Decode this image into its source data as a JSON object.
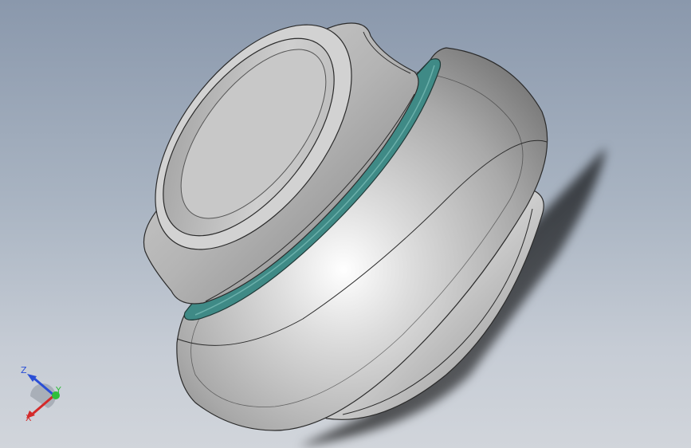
{
  "viewport": {
    "background_top": "#8a98ac",
    "background_bottom": "#d1d5db"
  },
  "model": {
    "name": "bearing-insert",
    "body_color": "#b9b9b9",
    "seal_color": "#3f8a86",
    "edge_color": "#2b2b2b"
  },
  "triad": {
    "z_label": "Z",
    "y_label": "Y",
    "x_label": "X",
    "z_color": "#2b4fd6",
    "y_color": "#2fbf3a",
    "x_color": "#d42a2a"
  }
}
